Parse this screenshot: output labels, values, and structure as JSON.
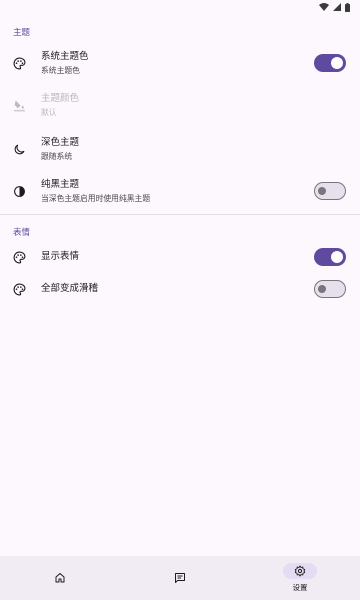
{
  "sections": {
    "theme_header": "主题",
    "emoji_header": "表情"
  },
  "theme": {
    "system_color": {
      "title": "系统主题色",
      "subtitle": "系统主题色",
      "icon": "palette-icon",
      "enabled": true
    },
    "theme_color": {
      "title": "主题颜色",
      "subtitle": "默认",
      "icon": "paint-bucket-icon",
      "disabled": true
    },
    "dark_theme": {
      "title": "深色主题",
      "subtitle": "跟随系统",
      "icon": "moon-icon"
    },
    "pure_black": {
      "title": "纯黑主题",
      "subtitle": "当深色主题启用时使用纯黑主题",
      "icon": "contrast-icon",
      "enabled": false
    }
  },
  "emoji": {
    "show_emoji": {
      "title": "显示表情",
      "icon": "palette-icon",
      "enabled": true
    },
    "all_funny": {
      "title": "全部变成滑稽",
      "icon": "palette-icon",
      "enabled": false
    }
  },
  "bottom_nav": {
    "items": [
      {
        "icon": "home-icon",
        "label": ""
      },
      {
        "icon": "message-icon",
        "label": ""
      },
      {
        "icon": "gear-icon",
        "label": "设置",
        "active": true
      }
    ]
  },
  "colors": {
    "accent": "#5f4aa0",
    "background": "#fdf8fd",
    "nav_background": "#f1ecf4"
  }
}
